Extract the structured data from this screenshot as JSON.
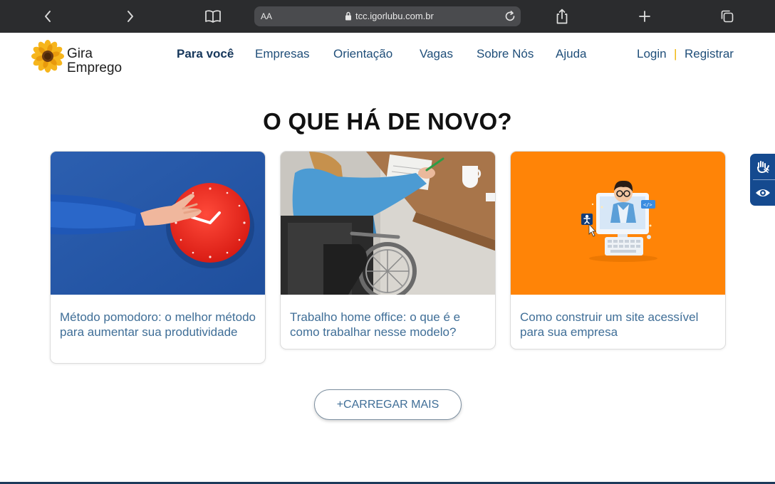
{
  "browser": {
    "url_aa": "AA",
    "url": "tcc.igorlubu.com.br",
    "icons": [
      "back-icon",
      "forward-icon",
      "bookmarks-icon",
      "lock-icon",
      "reload-icon",
      "share-icon",
      "new-tab-icon",
      "tabs-icon"
    ]
  },
  "header": {
    "logo_line1": "Gira",
    "logo_line2": "Emprego",
    "nav": [
      {
        "label": "Para você"
      },
      {
        "label": "Empresas"
      },
      {
        "label": "Orientação"
      },
      {
        "label": "Vagas"
      },
      {
        "label": "Sobre Nós"
      },
      {
        "label": "Ajuda"
      }
    ],
    "login": "Login",
    "separator": "|",
    "register": "Registrar"
  },
  "main": {
    "title": "O QUE HÁ DE NOVO?",
    "cards": [
      {
        "title": "Método pomodoro: o melhor método para aumentar sua produtividade"
      },
      {
        "title": "Trabalho home office: o que é e como trabalhar nesse modelo?"
      },
      {
        "title": "Como construir um site acessível para sua empresa"
      }
    ],
    "load_more": "+CARREGAR MAIS"
  },
  "colors": {
    "nav_text": "#1f4e79",
    "card_title": "#3f6e97",
    "accent_yellow": "#f0b400",
    "a11y_widget": "#154a8f",
    "browser_bar": "#2b2c2e"
  },
  "accessibility_widget": {
    "icons": [
      "sign-language-icon",
      "eye-icon"
    ]
  }
}
